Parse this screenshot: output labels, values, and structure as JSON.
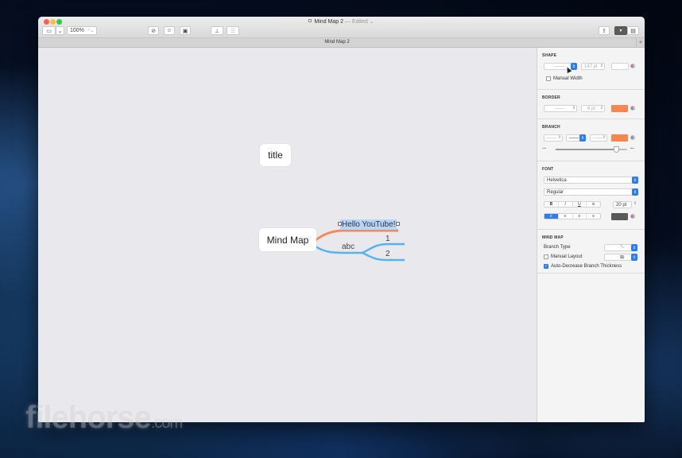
{
  "window": {
    "title": "Mind Map 2",
    "edited_label": "— Edited",
    "edited_chevron": "⌄"
  },
  "toolbar": {
    "sidebar_toggle_icon": "▭",
    "dropdown_chevron": "⌄",
    "zoom_value": "100%",
    "stepper": "⌃⌄",
    "buttons": [
      {
        "name": "no-style-button",
        "icon": "⊘"
      },
      {
        "name": "sticker-button",
        "icon": "☺"
      },
      {
        "name": "image-button",
        "icon": "▣"
      },
      {
        "name": "add-child-button",
        "icon": "⊥"
      },
      {
        "name": "note-button",
        "icon": "☰"
      }
    ],
    "share_icon": "⇧",
    "format_icon": "▼",
    "document_icon": "▤"
  },
  "tabs": {
    "active_label": "Mind Map 2",
    "add_label": "+"
  },
  "canvas": {
    "nodes": {
      "title": "title",
      "root": "Mind Map",
      "branch_selected": "Hello YouTube!",
      "branch_abc": "abc",
      "leaf_1": "1",
      "leaf_2": "2"
    },
    "colors": {
      "branch_orange": "#f28a5b",
      "branch_blue": "#55b3ee",
      "selection": "#b5d5fb"
    }
  },
  "inspector": {
    "shape": {
      "title": "SHAPE",
      "shape_select": "——",
      "width_value": "147 pt",
      "manual_width_label": "Manual Width",
      "manual_width_checked": false
    },
    "border": {
      "title": "BORDER",
      "style_select": "——",
      "width_value": "6 pt",
      "color": "#f8874f"
    },
    "branch": {
      "title": "BRANCH",
      "style_select_1": "——",
      "style_select_2": "——",
      "style_select_3": "——",
      "color": "#f8874f",
      "thickness_fraction": 0.85
    },
    "font": {
      "title": "FONT",
      "family": "Helvetica",
      "style": "Regular",
      "bold": "B",
      "italic": "I",
      "underline": "U",
      "strike": "S",
      "size": "20 pt",
      "align_left": "≡",
      "align_center": "≡",
      "align_right": "≡",
      "align_justify": "≡",
      "color": "#5a5a5a"
    },
    "mindmap": {
      "title": "MIND MAP",
      "branch_type_label": "Branch Type",
      "branch_type_value": "⟍",
      "manual_layout_label": "Manual Layout",
      "manual_layout_checked": false,
      "layout_value": "⊞",
      "auto_decrease_label": "Auto-Decrease Branch Thickness",
      "auto_decrease_checked": true
    }
  },
  "watermark": {
    "text": "filehorse",
    "suffix": ".com"
  }
}
